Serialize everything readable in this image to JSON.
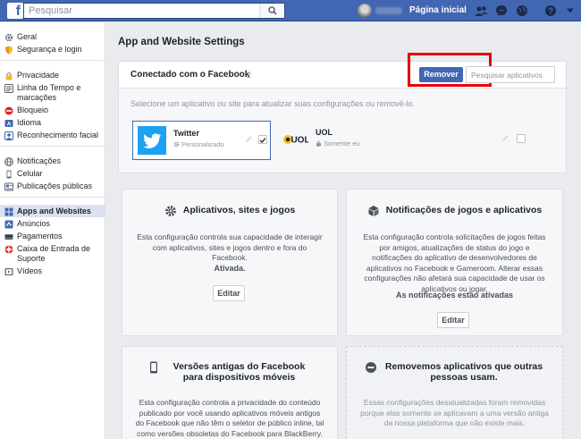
{
  "topbar": {
    "logo": "f",
    "search_placeholder": "Pesquisar",
    "home_label": "Página inicial",
    "brand_color": "#4267b2"
  },
  "sidebar": {
    "groups": [
      [
        {
          "label": "Geral",
          "icon": "gear-icon"
        },
        {
          "label": "Segurança e login",
          "icon": "shield-icon"
        }
      ],
      [
        {
          "label": "Privacidade",
          "icon": "lock-icon"
        },
        {
          "label": "Linha do Tempo e marcações",
          "icon": "timeline-icon"
        },
        {
          "label": "Bloqueio",
          "icon": "block-icon"
        },
        {
          "label": "Idioma",
          "icon": "language-icon"
        },
        {
          "label": "Reconhecimento facial",
          "icon": "face-icon"
        }
      ],
      [
        {
          "label": "Notificações",
          "icon": "globe-icon"
        },
        {
          "label": "Celular",
          "icon": "mobile-icon"
        },
        {
          "label": "Publicações públicas",
          "icon": "public-posts-icon"
        }
      ],
      [
        {
          "label": "Apps and Websites",
          "icon": "apps-icon",
          "active": true
        },
        {
          "label": "Anúncios",
          "icon": "ads-icon"
        },
        {
          "label": "Pagamentos",
          "icon": "payments-icon"
        },
        {
          "label": "Caixa de Entrada de Suporte",
          "icon": "support-inbox-icon"
        },
        {
          "label": "Vídeos",
          "icon": "videos-icon"
        }
      ]
    ]
  },
  "main": {
    "title": "App and Website Settings",
    "connected": {
      "title": "Conectado com o Facebook",
      "count": "2",
      "remove_label": "Remover",
      "search_placeholder": "Pesquisar aplicativos",
      "hint": "Selecione um aplicativo ou site para atualizar suas configurações ou removê-lo.",
      "apps": [
        {
          "name": "Twitter",
          "privacy": "Personalizado",
          "privacy_icon": "gear-icon",
          "checked": true
        },
        {
          "name": "UOL",
          "privacy": "Somente eu",
          "privacy_icon": "lock-icon",
          "checked": false
        }
      ]
    },
    "cards": {
      "apps": {
        "title": "Aplicativos, sites e jogos",
        "desc": "Esta configuração controla sua capacidade de interagir com aplicativos, sites e jogos dentro e fora do Facebook.",
        "status": "Ativada.",
        "edit_label": "Editar"
      },
      "notifications": {
        "title": "Notificações de jogos e aplicativos",
        "desc": "Esta configuração controla solicitações de jogos feitas por amigos, atualizações de status do jogo e notificações do aplicativo de desenvolvedores de aplicativos no Facebook e Gameroom. Alterar essas configurações não afetará sua capacidade de usar os aplicativos ou jogar.",
        "status": "As notificações estão ativadas",
        "edit_label": "Editar"
      },
      "old_versions": {
        "title": "Versões antigas do Facebook para dispositivos móveis",
        "desc": "Esta configuração controla a privacidade do conteúdo publicado por você usando aplicativos móveis antigos do Facebook que não têm o seletor de público inline, tal como versões obsoletas do Facebook para BlackBerry."
      },
      "removed": {
        "title": "Removemos aplicativos que outras pessoas usam.",
        "desc": "Essas configurações desatualizadas foram removidas porque elas somente se aplicavam a uma versão antiga da nossa plataforma que não existe mais."
      }
    }
  }
}
